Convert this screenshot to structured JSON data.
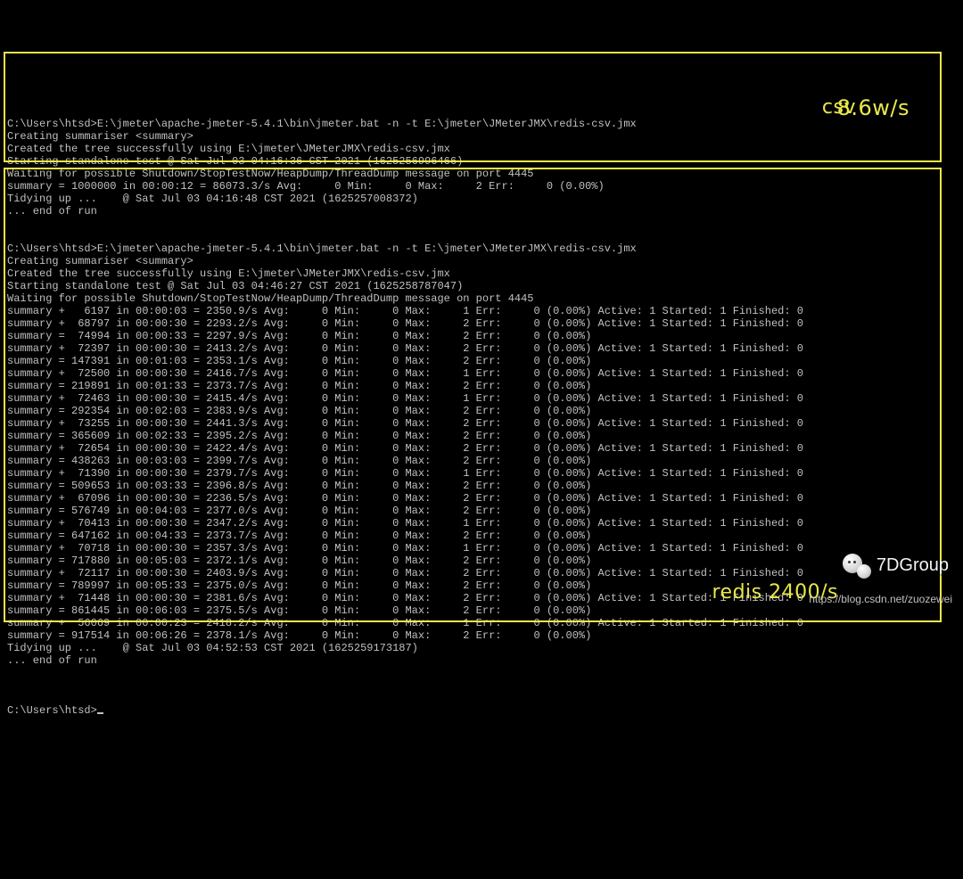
{
  "top": {
    "prelines": [
      "C:\\Users\\htsd>E:\\jmeter\\apache-jmeter-5.4.1\\bin\\jmeter.bat -n -t E:\\jmeter\\JMeterJMX\\redis-csv.jmx",
      "Creating summariser <summary>",
      "Created the tree successfully using E:\\jmeter\\JMeterJMX\\redis-csv.jmx",
      "Starting standalone test @ Sat Jul 03 04:16:36 CST 2021 (1625256996466)",
      "Waiting for possible Shutdown/StopTestNow/HeapDump/ThreadDump message on port 4445",
      "summary = 1000000 in 00:00:12 = 86073.3/s Avg:     0 Min:     0 Max:     2 Err:     0 (0.00%)",
      "Tidying up ...    @ Sat Jul 03 04:16:48 CST 2021 (1625257008372)",
      "... end of run"
    ]
  },
  "bottom": {
    "prelines": [
      "C:\\Users\\htsd>E:\\jmeter\\apache-jmeter-5.4.1\\bin\\jmeter.bat -n -t E:\\jmeter\\JMeterJMX\\redis-csv.jmx",
      "Creating summariser <summary>",
      "Created the tree successfully using E:\\jmeter\\JMeterJMX\\redis-csv.jmx",
      "Starting standalone test @ Sat Jul 03 04:46:27 CST 2021 (1625258787047)",
      "Waiting for possible Shutdown/StopTestNow/HeapDump/ThreadDump message on port 4445"
    ],
    "rows": [
      {
        "op": "+",
        "n": "6197",
        "t": "00:00:03",
        "rate": "2350.9",
        "max": "1",
        "afs": true
      },
      {
        "op": "+",
        "n": "68797",
        "t": "00:00:30",
        "rate": "2293.2",
        "max": "2",
        "afs": true
      },
      {
        "op": "=",
        "n": "74994",
        "t": "00:00:33",
        "rate": "2297.9",
        "max": "2",
        "afs": false
      },
      {
        "op": "+",
        "n": "72397",
        "t": "00:00:30",
        "rate": "2413.2",
        "max": "2",
        "afs": true
      },
      {
        "op": "=",
        "n": "147391",
        "t": "00:01:03",
        "rate": "2353.1",
        "max": "2",
        "afs": false
      },
      {
        "op": "+",
        "n": "72500",
        "t": "00:00:30",
        "rate": "2416.7",
        "max": "1",
        "afs": true
      },
      {
        "op": "=",
        "n": "219891",
        "t": "00:01:33",
        "rate": "2373.7",
        "max": "2",
        "afs": false
      },
      {
        "op": "+",
        "n": "72463",
        "t": "00:00:30",
        "rate": "2415.4",
        "max": "1",
        "afs": true
      },
      {
        "op": "=",
        "n": "292354",
        "t": "00:02:03",
        "rate": "2383.9",
        "max": "2",
        "afs": false
      },
      {
        "op": "+",
        "n": "73255",
        "t": "00:00:30",
        "rate": "2441.3",
        "max": "2",
        "afs": true
      },
      {
        "op": "=",
        "n": "365609",
        "t": "00:02:33",
        "rate": "2395.2",
        "max": "2",
        "afs": false
      },
      {
        "op": "+",
        "n": "72654",
        "t": "00:00:30",
        "rate": "2422.4",
        "max": "2",
        "afs": true
      },
      {
        "op": "=",
        "n": "438263",
        "t": "00:03:03",
        "rate": "2399.7",
        "max": "2",
        "afs": false
      },
      {
        "op": "+",
        "n": "71390",
        "t": "00:00:30",
        "rate": "2379.7",
        "max": "1",
        "afs": true
      },
      {
        "op": "=",
        "n": "509653",
        "t": "00:03:33",
        "rate": "2396.8",
        "max": "2",
        "afs": false
      },
      {
        "op": "+",
        "n": "67096",
        "t": "00:00:30",
        "rate": "2236.5",
        "max": "2",
        "afs": true
      },
      {
        "op": "=",
        "n": "576749",
        "t": "00:04:03",
        "rate": "2377.0",
        "max": "2",
        "afs": false
      },
      {
        "op": "+",
        "n": "70413",
        "t": "00:00:30",
        "rate": "2347.2",
        "max": "1",
        "afs": true
      },
      {
        "op": "=",
        "n": "647162",
        "t": "00:04:33",
        "rate": "2373.7",
        "max": "2",
        "afs": false
      },
      {
        "op": "+",
        "n": "70718",
        "t": "00:00:30",
        "rate": "2357.3",
        "max": "1",
        "afs": true
      },
      {
        "op": "=",
        "n": "717880",
        "t": "00:05:03",
        "rate": "2372.1",
        "max": "2",
        "afs": false
      },
      {
        "op": "+",
        "n": "72117",
        "t": "00:00:30",
        "rate": "2403.9",
        "max": "2",
        "afs": true
      },
      {
        "op": "=",
        "n": "789997",
        "t": "00:05:33",
        "rate": "2375.0",
        "max": "2",
        "afs": false
      },
      {
        "op": "+",
        "n": "71448",
        "t": "00:00:30",
        "rate": "2381.6",
        "max": "2",
        "afs": true
      },
      {
        "op": "=",
        "n": "861445",
        "t": "00:06:03",
        "rate": "2375.5",
        "max": "2",
        "afs": false
      },
      {
        "op": "+",
        "n": "56069",
        "t": "00:00:23",
        "rate": "2418.2",
        "max": "1",
        "afs": true
      },
      {
        "op": "=",
        "n": "917514",
        "t": "00:06:26",
        "rate": "2378.1",
        "max": "2",
        "afs": false
      }
    ],
    "postlines": [
      "Tidying up ...    @ Sat Jul 03 04:52:53 CST 2021 (1625259173187)",
      "... end of run",
      ""
    ]
  },
  "prompt": "C:\\Users\\htsd>",
  "annotations": {
    "csv_label": "csv",
    "csv_rate": "8.6w/s",
    "redis_label": "redis 2400/s"
  },
  "watermark": {
    "text": "7DGroup"
  },
  "footer": {
    "url": "https://blog.csdn.net/zuozewei"
  }
}
